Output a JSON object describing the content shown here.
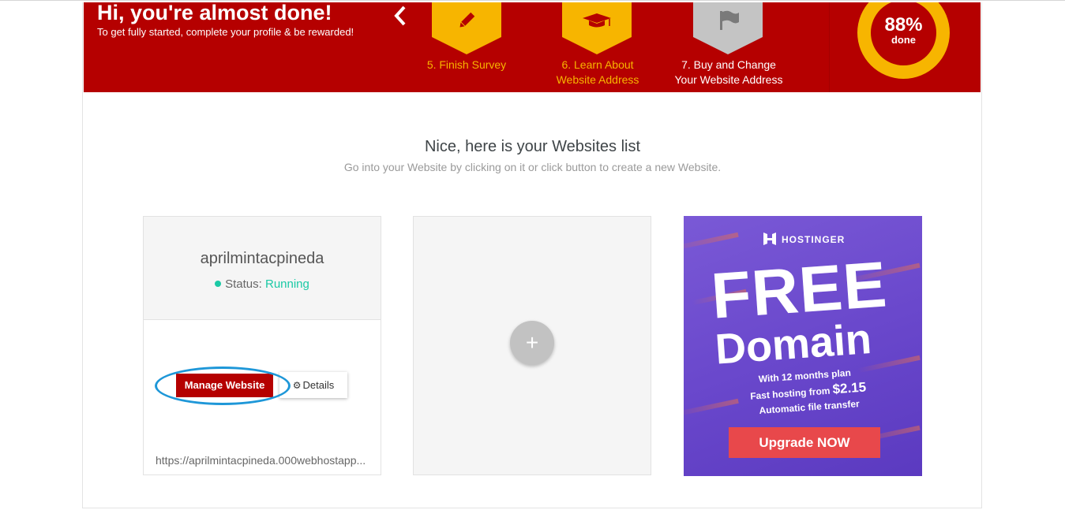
{
  "banner": {
    "title": "Hi, you're almost done!",
    "subtitle": "To get fully started, complete your profile & be rewarded!",
    "steps": [
      {
        "line1": "5. Finish Survey",
        "line2": "",
        "icon": "pencil-icon",
        "color": "#f7b500",
        "label_color": "#f7b500"
      },
      {
        "line1": "6. Learn About",
        "line2": "Website Address",
        "icon": "graduation-cap-icon",
        "color": "#f7b500",
        "label_color": "#f7b500"
      },
      {
        "line1": "7. Buy and Change",
        "line2": "Your Website Address",
        "icon": "flag-icon",
        "color": "#c4c4c4",
        "label_color": "#ffffff"
      }
    ],
    "progress_text": "88%",
    "progress_value": 88,
    "progress_caption": "done"
  },
  "websites": {
    "title": "Nice, here is your Websites list",
    "subtitle": "Go into your Website by clicking on it or click button to create a new Website.",
    "site": {
      "name": "aprilmintacpineda",
      "status_label": "Status:",
      "status_value": "Running",
      "manage_label": "Manage Website",
      "details_label": "Details",
      "url": "https://aprilmintacpineda.000webhostapp..."
    },
    "add_label": "+"
  },
  "ad": {
    "brand": "HOSTINGER",
    "headline": "FREE",
    "subheadline": "Domain",
    "line1": "With 12 months plan",
    "line2_prefix": "Fast hosting from ",
    "line2_price": "$2.15",
    "line3": "Automatic file transfer",
    "cta": "Upgrade NOW"
  },
  "colors": {
    "brand_red": "#b50000",
    "accent_yellow": "#f7b500",
    "status_green": "#1bc9a5",
    "highlight_blue": "#1e97d8",
    "ad_purple": "#6a48cc",
    "ad_cta": "#e8484b"
  }
}
